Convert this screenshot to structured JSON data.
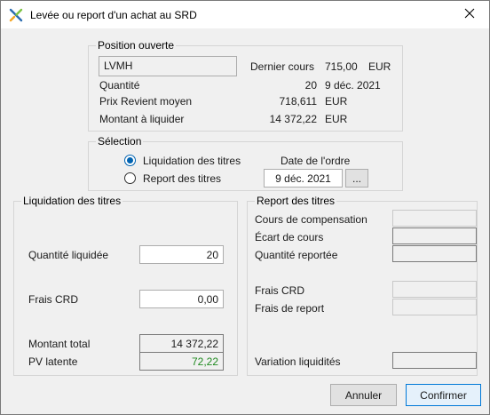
{
  "window": {
    "title": "Levée ou report d'un achat au SRD",
    "icon": "app-x-icon",
    "close_icon": "close-icon"
  },
  "position_ouverte": {
    "legend": "Position ouverte",
    "name": "LVMH",
    "dernier_cours_label": "Dernier cours",
    "dernier_cours_value": "715,00",
    "dernier_cours_currency": "EUR",
    "quantite_label": "Quantité",
    "quantite_value": "20",
    "quantite_date": "9 déc. 2021",
    "prix_label": "Prix Revient moyen",
    "prix_value": "718,611",
    "prix_currency": "EUR",
    "montant_label": "Montant à liquider",
    "montant_value": "14 372,22",
    "montant_currency": "EUR"
  },
  "selection": {
    "legend": "Sélection",
    "option_liquidation": "Liquidation des titres",
    "option_report": "Report des titres",
    "selected": "liquidation",
    "date_ordre_label": "Date de l'ordre",
    "date_ordre_value": "9 déc. 2021",
    "date_picker_label": "..."
  },
  "liquidation": {
    "legend": "Liquidation des titres",
    "quantite_label": "Quantité liquidée",
    "quantite_value": "20",
    "frais_label": "Frais CRD",
    "frais_value": "0,00",
    "montant_total_label": "Montant total",
    "montant_total_value": "14 372,22",
    "pv_latente_label": "PV latente",
    "pv_latente_value": "72,22",
    "pv_color": "#1f8a1f"
  },
  "report": {
    "legend": "Report des titres",
    "cours_comp_label": "Cours de compensation",
    "ecart_label": "Écart de cours",
    "quantite_reportee_label": "Quantité reportée",
    "frais_crd_label": "Frais CRD",
    "frais_report_label": "Frais de report",
    "variation_label": "Variation liquidités"
  },
  "buttons": {
    "annuler": "Annuler",
    "confirmer": "Confirmer"
  },
  "colors": {
    "accent": "#0078d7",
    "radio": "#0063b1"
  }
}
